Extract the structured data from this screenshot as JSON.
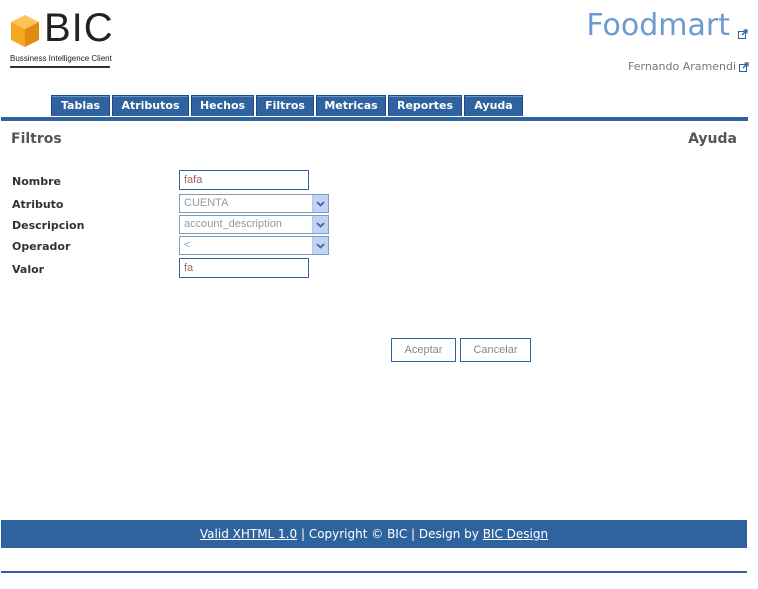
{
  "logo": {
    "brand": "BIC",
    "subtitle": "Bussiness Intelligence Client"
  },
  "header": {
    "site_title": "Foodmart",
    "user_name": "Fernando Aramendi"
  },
  "nav": {
    "tabs": [
      "Tablas",
      "Atributos",
      "Hechos",
      "Filtros",
      "Metricas",
      "Reportes",
      "Ayuda"
    ]
  },
  "page": {
    "heading": "Filtros",
    "help_link": "Ayuda"
  },
  "form": {
    "nombre_label": "Nombre",
    "nombre_value": "fafa",
    "atributo_label": "Atributo",
    "atributo_value": "CUENTA",
    "descripcion_label": "Descripcion",
    "descripcion_value": "account_description",
    "operador_label": "Operador",
    "operador_value": "<",
    "valor_label": "Valor",
    "valor_value": "fa",
    "accept_label": "Aceptar",
    "cancel_label": "Cancelar"
  },
  "footer": {
    "valid_link": "Valid XHTML 1.0",
    "sep1": " | ",
    "copyright": "Copyright © BIC",
    "sep2": " | Design by ",
    "design_link": "BIC Design"
  },
  "colors": {
    "accent": "#2f63a0",
    "title_blue": "#6b9bd2",
    "logo_orange": "#f5a623"
  },
  "icons": {
    "external": "external-link-icon",
    "dropdown": "chevron-down-icon"
  }
}
